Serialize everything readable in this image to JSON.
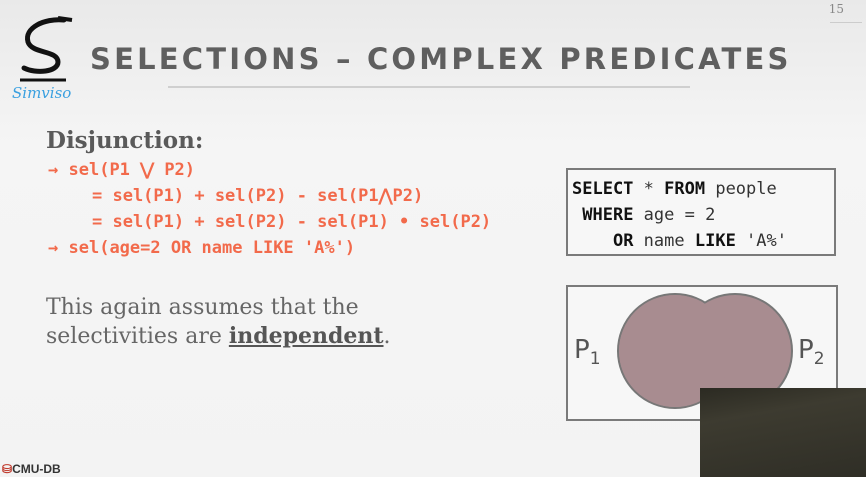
{
  "slide": {
    "page_number": "15",
    "title": "SELECTIONS – COMPLEX PREDICATES",
    "logo_text": "Simviso",
    "footer_logo": "CMU-DB",
    "heading": "Disjunction:",
    "formula_lines": [
      {
        "arrow": "→",
        "text": "sel(P1 ⋁ P2)"
      },
      {
        "arrow": "",
        "text": "= sel(P1) + sel(P2) - sel(P1⋀P2)"
      },
      {
        "arrow": "",
        "text": "= sel(P1) + sel(P2) - sel(P1) • sel(P2)"
      },
      {
        "arrow": "→",
        "text": "sel(age=2 OR name LIKE 'A%')"
      }
    ],
    "paragraph_prefix": "This again assumes that the selectivities are ",
    "paragraph_emphasis": "independent",
    "paragraph_suffix": ".",
    "sql": {
      "l1_kw1": "SELECT",
      "l1_rest": " * ",
      "l1_kw2": "FROM",
      "l1_table": " people",
      "l2_kw": "WHERE",
      "l2_rest": " age = 2",
      "l3_kw": "OR",
      "l3_mid": " name ",
      "l3_kw2": "LIKE",
      "l3_rest": " 'A%'"
    },
    "venn": {
      "left_label": "P",
      "left_sub": "1",
      "right_label": "P",
      "right_sub": "2",
      "fill": "#a88c90"
    },
    "colors": {
      "accent": "#f26a4b",
      "title": "#5f5f5f"
    }
  }
}
